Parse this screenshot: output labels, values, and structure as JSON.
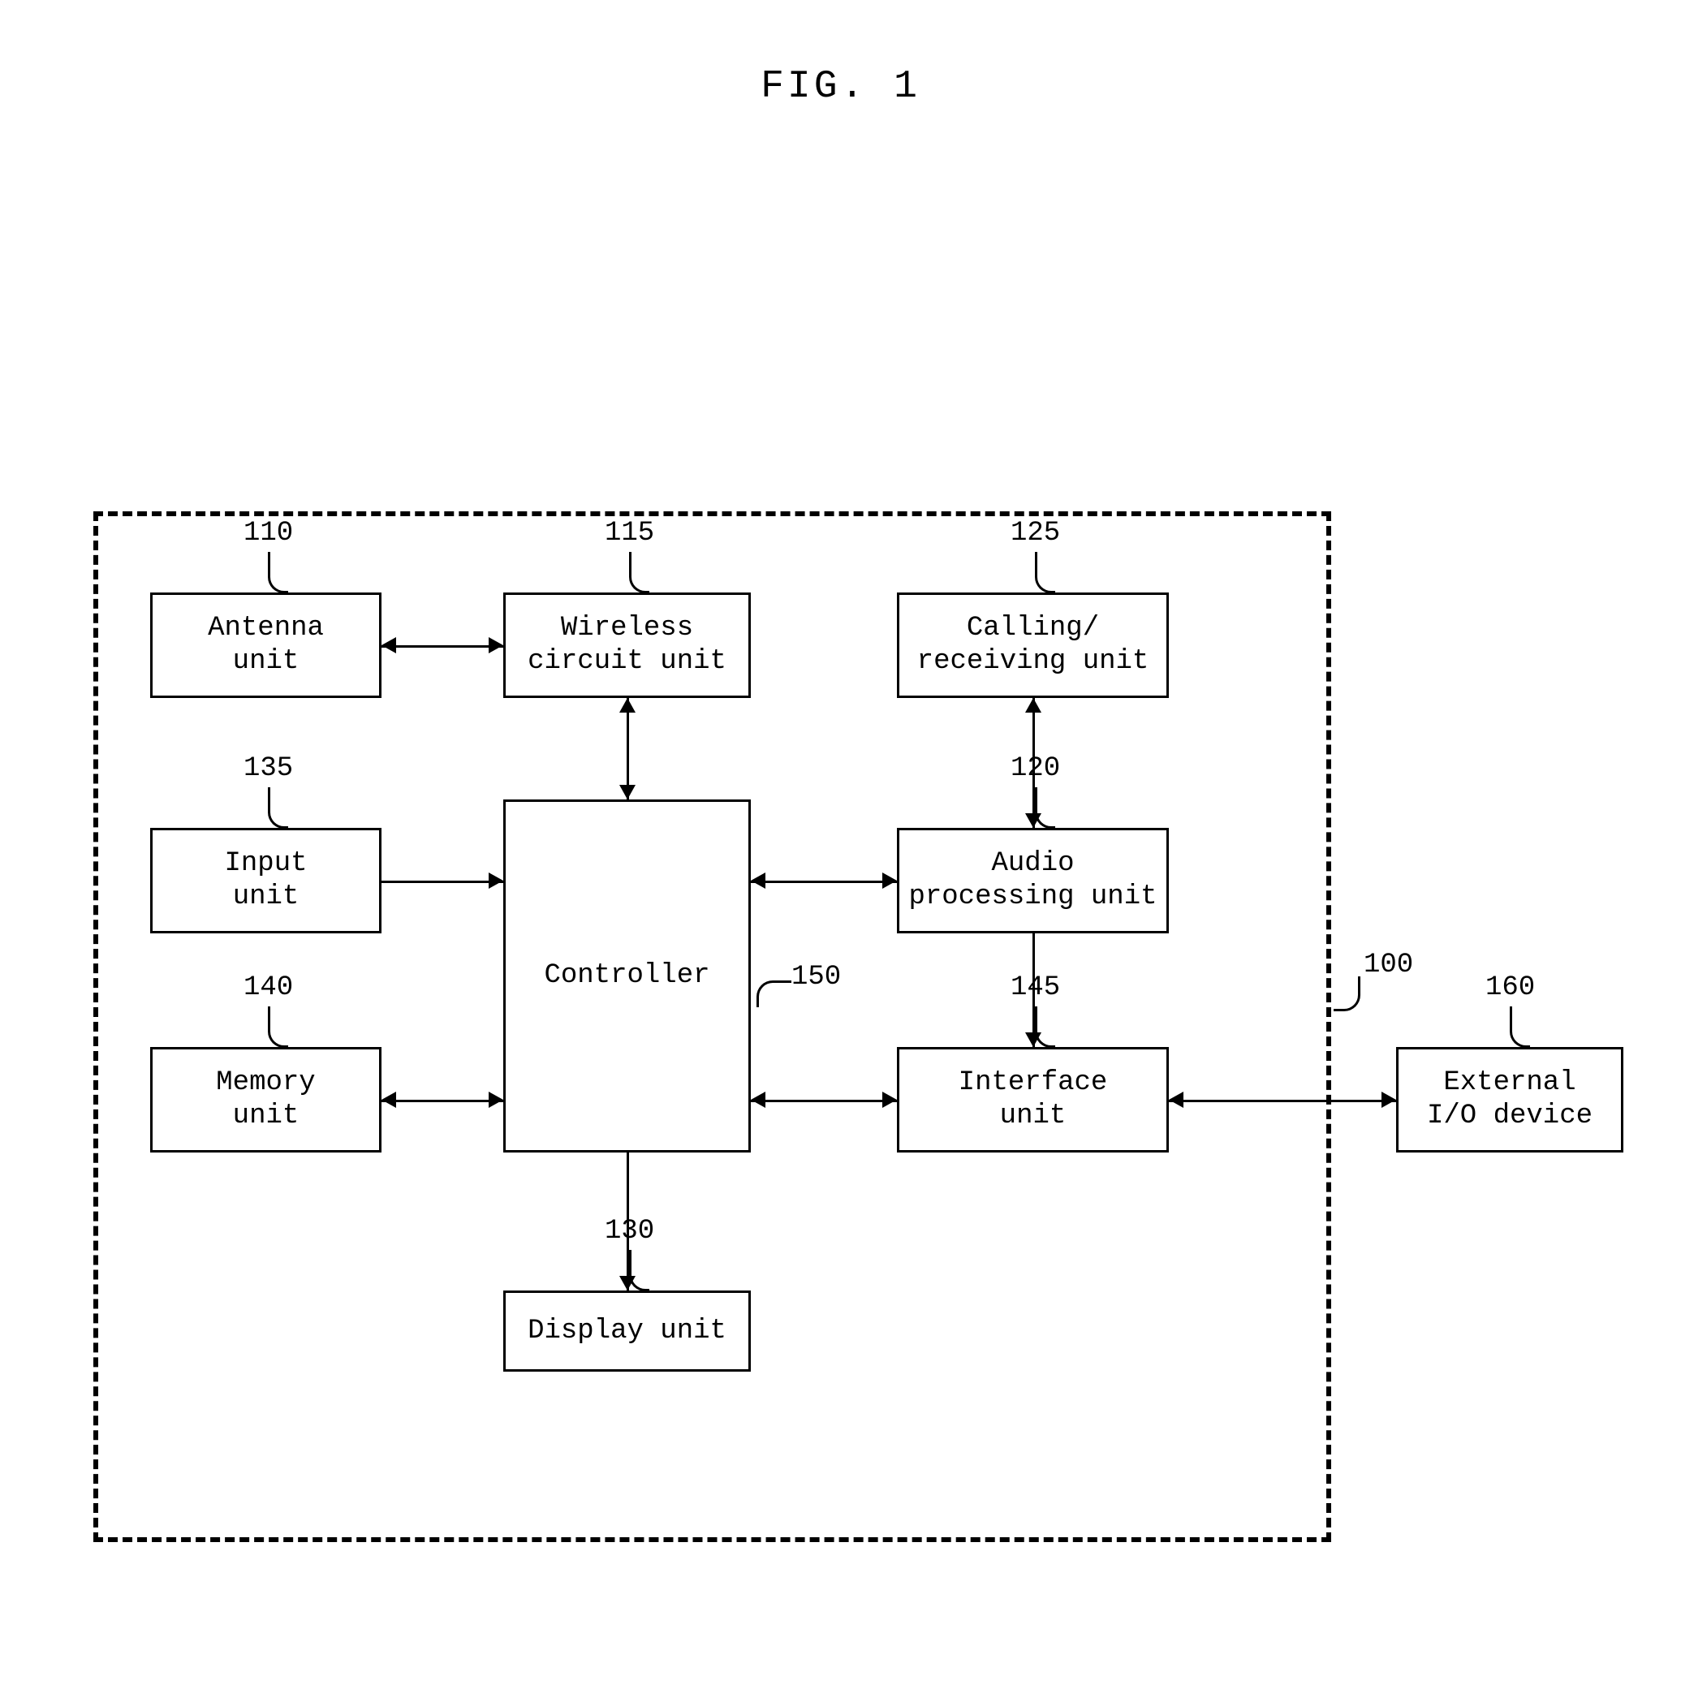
{
  "figure_title": "FIG. 1",
  "boundary": {
    "ref": "100"
  },
  "blocks": {
    "antenna": {
      "ref": "110",
      "label": "Antenna\nunit"
    },
    "wireless": {
      "ref": "115",
      "label": "Wireless\ncircuit unit"
    },
    "calling": {
      "ref": "125",
      "label": "Calling/\nreceiving unit"
    },
    "input": {
      "ref": "135",
      "label": "Input\nunit"
    },
    "memory": {
      "ref": "140",
      "label": "Memory\nunit"
    },
    "controller": {
      "ref": "150",
      "label": "Controller"
    },
    "audio": {
      "ref": "120",
      "label": "Audio\nprocessing unit"
    },
    "interface": {
      "ref": "145",
      "label": "Interface\nunit"
    },
    "display": {
      "ref": "130",
      "label": "Display unit"
    },
    "external": {
      "ref": "160",
      "label": "External\nI/O device"
    }
  },
  "connections": [
    {
      "from": "antenna",
      "to": "wireless",
      "dir": "both"
    },
    {
      "from": "wireless",
      "to": "controller",
      "dir": "both"
    },
    {
      "from": "calling",
      "to": "audio",
      "dir": "both"
    },
    {
      "from": "input",
      "to": "controller",
      "dir": "to"
    },
    {
      "from": "memory",
      "to": "controller",
      "dir": "both"
    },
    {
      "from": "controller",
      "to": "audio",
      "dir": "both"
    },
    {
      "from": "audio",
      "to": "interface",
      "dir": "to"
    },
    {
      "from": "controller",
      "to": "interface",
      "dir": "both"
    },
    {
      "from": "controller",
      "to": "display",
      "dir": "to"
    },
    {
      "from": "interface",
      "to": "external",
      "dir": "both"
    }
  ]
}
